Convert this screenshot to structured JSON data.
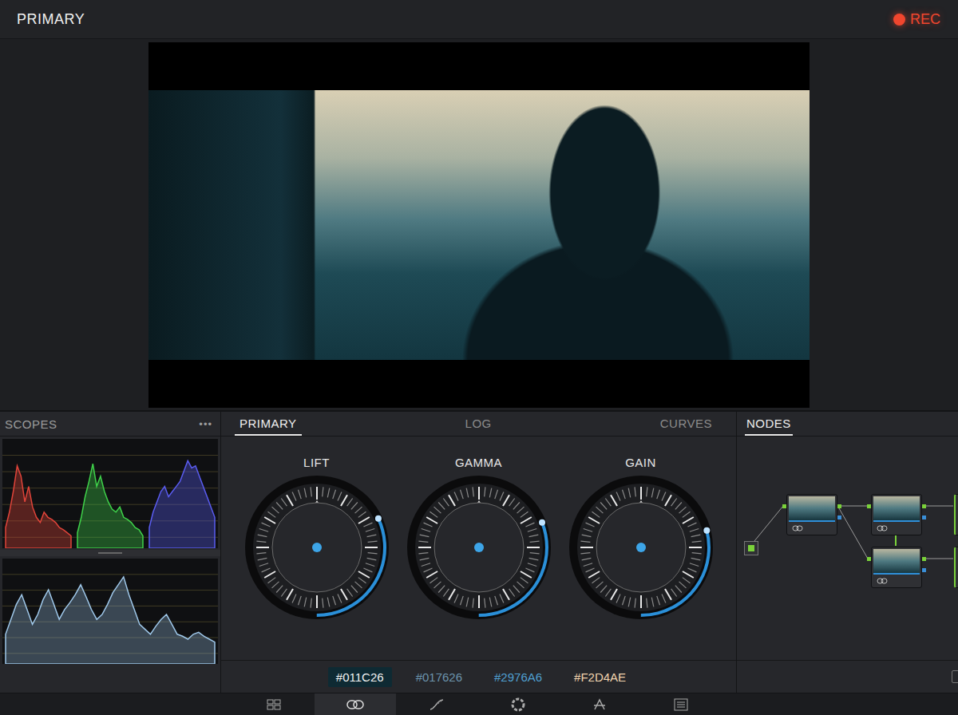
{
  "header": {
    "title": "PRIMARY",
    "record": {
      "label": "REC",
      "on": true
    }
  },
  "scopes": {
    "title": "SCOPES",
    "menu": "•••",
    "parade": [
      {
        "channel": "red",
        "color": "#e0443a",
        "values": [
          20,
          35,
          55,
          80,
          70,
          45,
          60,
          40,
          30,
          25,
          35,
          30,
          28,
          25,
          20,
          18,
          15,
          12
        ]
      },
      {
        "channel": "green",
        "color": "#3fd24a",
        "values": [
          15,
          30,
          50,
          65,
          82,
          60,
          70,
          55,
          45,
          38,
          35,
          40,
          30,
          28,
          25,
          20,
          18,
          12
        ]
      },
      {
        "channel": "blue",
        "color": "#5a5cf0",
        "values": [
          20,
          35,
          45,
          55,
          60,
          50,
          55,
          60,
          65,
          75,
          85,
          78,
          80,
          70,
          60,
          50,
          40,
          30
        ]
      }
    ],
    "waveform": {
      "color": "#9fc8ea",
      "values": [
        30,
        45,
        60,
        70,
        55,
        40,
        50,
        65,
        75,
        60,
        45,
        55,
        62,
        70,
        80,
        68,
        55,
        45,
        50,
        60,
        72,
        80,
        88,
        70,
        55,
        40,
        35,
        30,
        38,
        45,
        50,
        40,
        30,
        28,
        25,
        30,
        32,
        28,
        25,
        22
      ]
    }
  },
  "tabs": [
    {
      "label": "PRIMARY",
      "selected": true
    },
    {
      "label": "LOG",
      "selected": false
    },
    {
      "label": "CURVES",
      "selected": false
    }
  ],
  "wheels": [
    {
      "label": "LIFT",
      "level": 0.32
    },
    {
      "label": "GAMMA",
      "level": 0.31
    },
    {
      "label": "GAIN",
      "level": 0.29
    }
  ],
  "swatches": [
    {
      "label": "#011C26",
      "selected": true,
      "color": "#0e2a33"
    },
    {
      "label": "#017626",
      "selected": false,
      "color": "#6b93ab"
    },
    {
      "label": "#2976A6",
      "selected": false,
      "color": "#4f9fd0"
    },
    {
      "label": "#F2D4AE",
      "selected": false,
      "color": "#f2d4ae"
    }
  ],
  "nodes": {
    "title": "NODES",
    "selected": true
  },
  "toolbar": [
    {
      "selected": false
    },
    {
      "selected": true
    },
    {
      "selected": false
    },
    {
      "selected": false
    },
    {
      "selected": false
    },
    {
      "selected": false
    }
  ]
}
